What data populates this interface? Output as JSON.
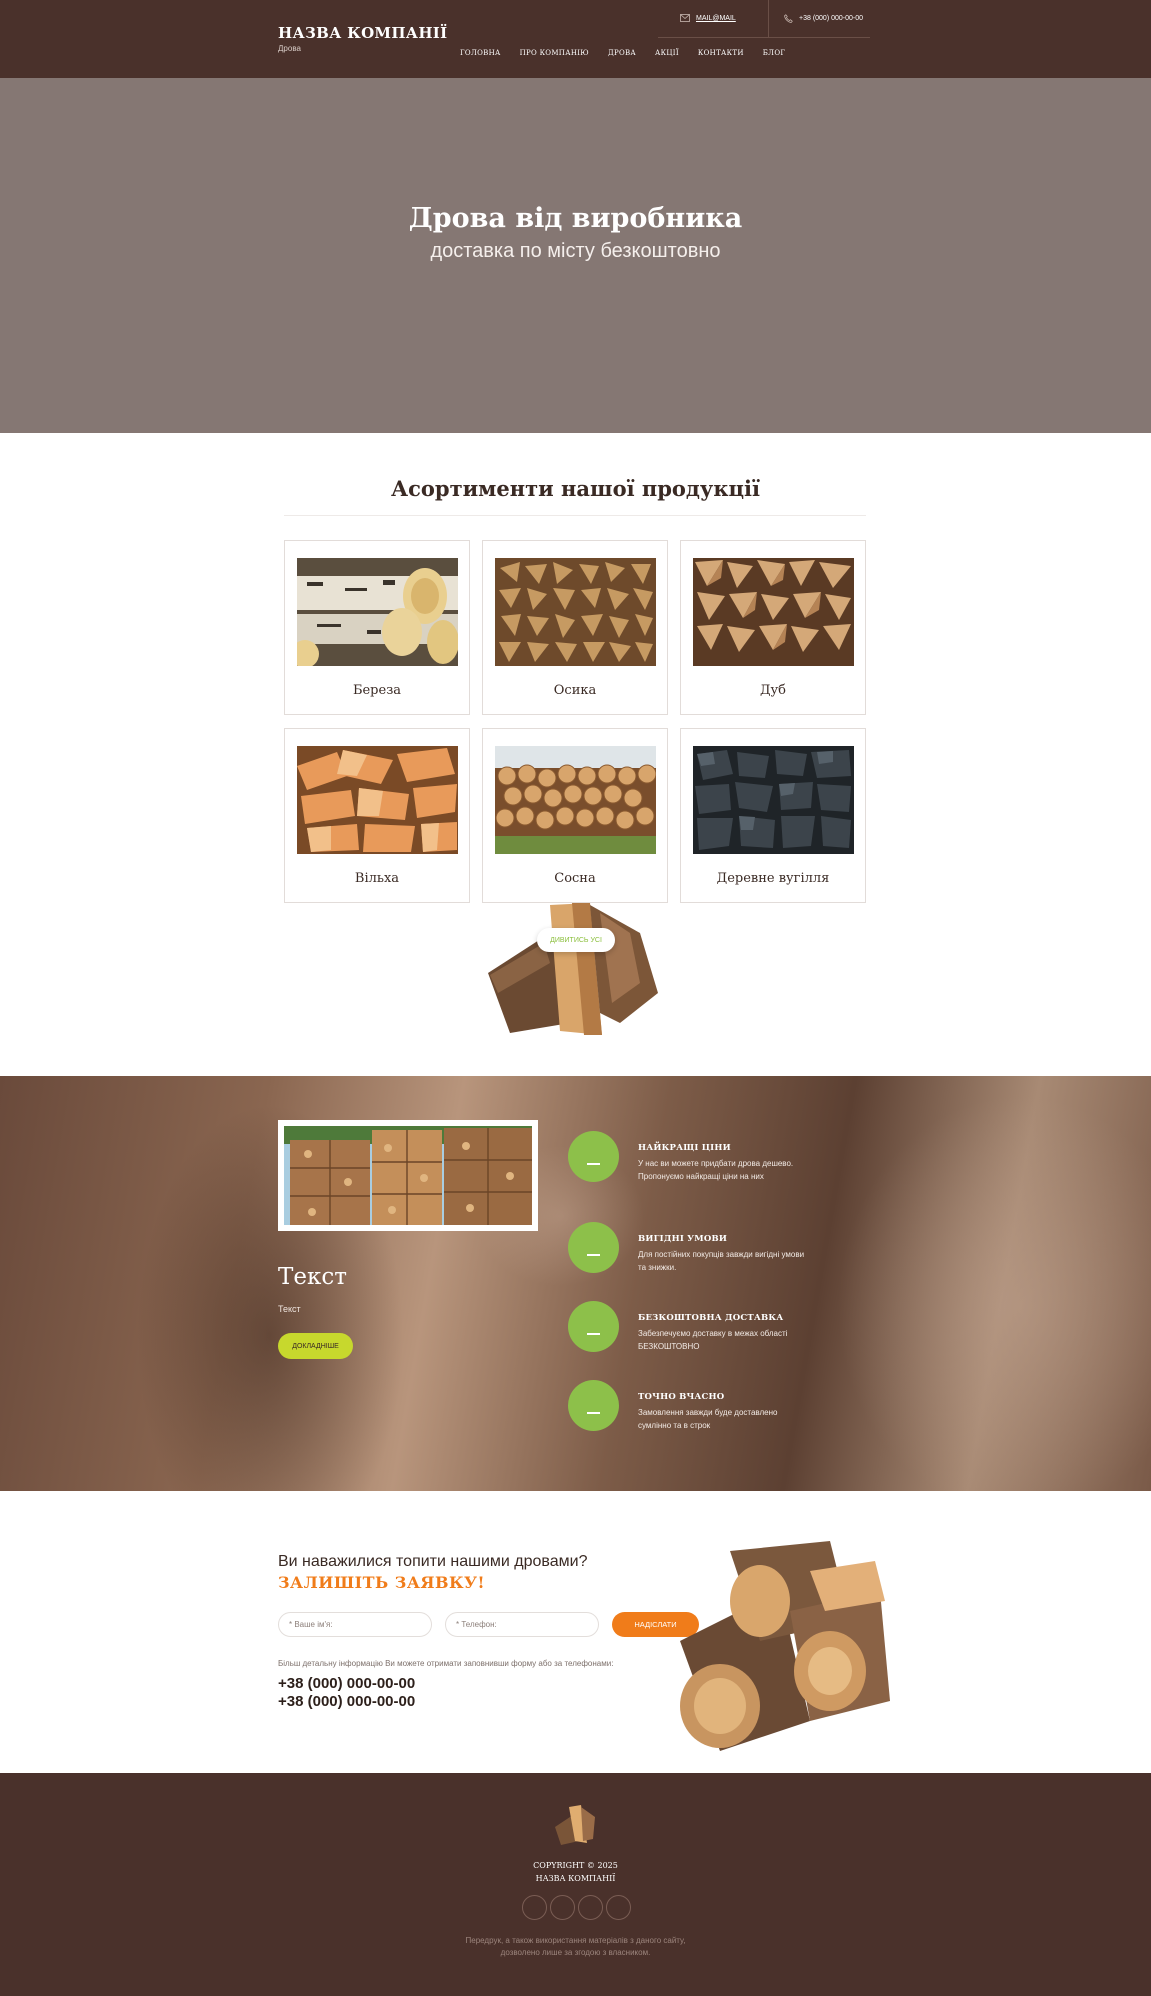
{
  "header": {
    "brand_title": "НАЗВА КОМПАНІЇ",
    "brand_sub": "Дрова",
    "email": "MAIL@MAIL",
    "phone": "+38 (000) 000-00-00",
    "nav": [
      "ГОЛОВНА",
      "ПРО КОМПАНІЮ",
      "ДРОВА",
      "АКЦІЇ",
      "КОНТАКТИ",
      "БЛОГ"
    ]
  },
  "hero": {
    "title": "Дрова від виробника",
    "subtitle": "доставка по місту безкоштовно"
  },
  "products": {
    "title": "Асортименти нашої продукції",
    "items": [
      {
        "name": "Береза",
        "icon": "birch-logs-image"
      },
      {
        "name": "Осика",
        "icon": "aspen-firewood-image"
      },
      {
        "name": "Дуб",
        "icon": "oak-firewood-image"
      },
      {
        "name": "Вільха",
        "icon": "alder-firewood-image"
      },
      {
        "name": "Сосна",
        "icon": "pine-logs-image"
      },
      {
        "name": "Деревне вугілля",
        "icon": "charcoal-image"
      }
    ],
    "see_all": "ДИВИТИСЬ УСІ"
  },
  "features": {
    "heading": "Текст",
    "text": "Текст",
    "more_button": "ДОКЛАДНІШЕ",
    "items": [
      {
        "title": "НАЙКРАЩІ ЦІНИ",
        "desc": "У нас ви можете придбати дрова дешево. Пропонуємо найкращі ціни на них"
      },
      {
        "title": "ВИГІДНІ УМОВИ",
        "desc": "Для постійних покупців завжди вигідні умови та знижки."
      },
      {
        "title": "БЕЗКОШТОВНА ДОСТАВКА",
        "desc": "Забезпечуємо доставку в межах області БЕЗКОШТОВНО"
      },
      {
        "title": "ТОЧНО ВЧАСНО",
        "desc": "Замовлення завжди буде доставлено сумлінно та в строк"
      }
    ]
  },
  "order": {
    "question": "Ви наважилися топити нашими дровами?",
    "cta": "ЗАЛИШІТЬ ЗАЯВКУ!",
    "name_placeholder": "* Ваше ім'я:",
    "phone_placeholder": "* Телефон:",
    "send": "НАДІСЛАТИ",
    "note": "Більш детальну інформацію Ви можете отримати заповнивши форму або за телефонами:",
    "phones": [
      "+38 (000) 000-00-00",
      "+38 (000) 000-00-00"
    ]
  },
  "footer": {
    "copyright": "COPYRIGHT © 2025",
    "company": "НАЗВА КОМПАНІЇ",
    "note_line1": "Передрук, а також використання матеріалів з даного сайту,",
    "note_line2": "дозволено лише за згодою з власником."
  },
  "colors": {
    "header_bg": "#4a312b",
    "hero_bg": "#857773",
    "accent_orange": "#f07c1a",
    "accent_green": "#8dc04a",
    "button_lime": "#c7d82d"
  }
}
